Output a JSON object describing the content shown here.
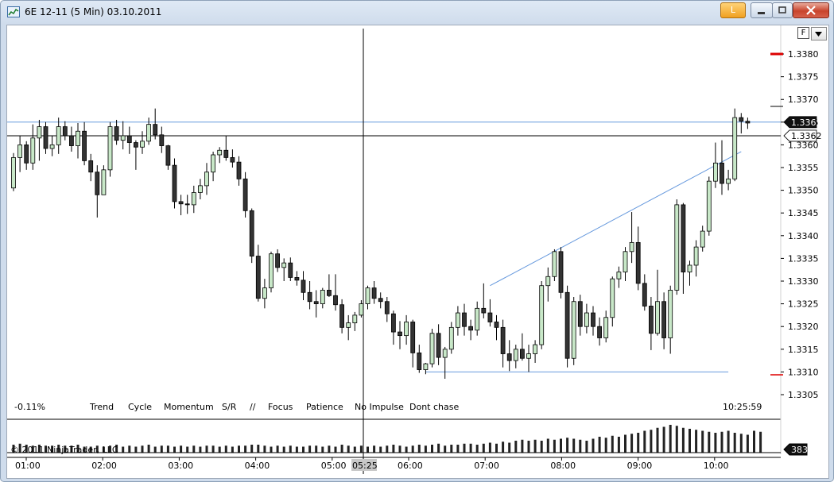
{
  "window": {
    "title": "6E 12-11 (5 Min)  03.10.2011",
    "l_button": "L",
    "f_button": "F"
  },
  "indicators": {
    "change_pct": "-0.11%",
    "labels": [
      "Trend",
      "Cycle",
      "Momentum",
      "S/R",
      "//",
      "Focus",
      "Patience",
      "No Impulse",
      "Dont chase"
    ],
    "clock": "10:25:59"
  },
  "copyright": "© 2011 NinjaTrader, LLC",
  "price_axis": {
    "ticks": [
      "1.3380",
      "1.3375",
      "1.3370",
      "1.3365",
      "1.3360",
      "1.3355",
      "1.3350",
      "1.3345",
      "1.3340",
      "1.3335",
      "1.3330",
      "1.3325",
      "1.3320",
      "1.3315",
      "1.3310",
      "1.3305"
    ],
    "last_price_label": "1.3365",
    "crosshair_price_label": "1.3362",
    "volume_label": "383"
  },
  "time_axis": {
    "ticks": [
      "01:00",
      "02:00",
      "03:00",
      "04:00",
      "05:00",
      "06:00",
      "07:00",
      "08:00",
      "09:00",
      "10:00"
    ],
    "crosshair_time_label": "05:25"
  },
  "colors": {
    "up_fill": "#c8e8c8",
    "down_fill": "#333333",
    "trendline": "#6699dd",
    "crosshair": "#000000",
    "marker_red": "#dd0000"
  },
  "chart_data": {
    "type": "candlestick",
    "instrument": "6E 12-11",
    "interval": "5 Min",
    "date": "03.10.2011",
    "ylim": [
      1.33025,
      1.3385
    ],
    "candles": [
      [
        1.33505,
        1.33582,
        1.33498,
        1.33572
      ],
      [
        1.33572,
        1.3362,
        1.3354,
        1.336
      ],
      [
        1.336,
        1.33608,
        1.33545,
        1.3356
      ],
      [
        1.3356,
        1.33645,
        1.33545,
        1.33615
      ],
      [
        1.33615,
        1.33655,
        1.33565,
        1.3364
      ],
      [
        1.3364,
        1.3365,
        1.3358,
        1.33592
      ],
      [
        1.33592,
        1.3362,
        1.33575,
        1.336
      ],
      [
        1.336,
        1.3366,
        1.3358,
        1.3364
      ],
      [
        1.3364,
        1.33652,
        1.3361,
        1.3362
      ],
      [
        1.3362,
        1.3364,
        1.33585,
        1.33598
      ],
      [
        1.33598,
        1.33648,
        1.3357,
        1.3363
      ],
      [
        1.3363,
        1.3365,
        1.33555,
        1.33565
      ],
      [
        1.33565,
        1.3358,
        1.3352,
        1.3354
      ],
      [
        1.3354,
        1.33555,
        1.3344,
        1.3349
      ],
      [
        1.3349,
        1.33555,
        1.3349,
        1.33545
      ],
      [
        1.33545,
        1.3365,
        1.3353,
        1.3364
      ],
      [
        1.3364,
        1.33655,
        1.336,
        1.3361
      ],
      [
        1.3361,
        1.33652,
        1.3359,
        1.3362
      ],
      [
        1.3362,
        1.3364,
        1.3358,
        1.33605
      ],
      [
        1.33605,
        1.3361,
        1.33545,
        1.33595
      ],
      [
        1.33595,
        1.3363,
        1.3358,
        1.33608
      ],
      [
        1.33608,
        1.3366,
        1.336,
        1.33645
      ],
      [
        1.33645,
        1.3368,
        1.33612,
        1.33622
      ],
      [
        1.33622,
        1.3364,
        1.33582,
        1.33598
      ],
      [
        1.33598,
        1.336,
        1.33545,
        1.33555
      ],
      [
        1.33555,
        1.3357,
        1.3346,
        1.33475
      ],
      [
        1.33475,
        1.3349,
        1.33445,
        1.3347
      ],
      [
        1.3347,
        1.3349,
        1.33448,
        1.33468
      ],
      [
        1.33468,
        1.3351,
        1.3345,
        1.33495
      ],
      [
        1.33495,
        1.33525,
        1.3348,
        1.3351
      ],
      [
        1.3351,
        1.3356,
        1.3349,
        1.3354
      ],
      [
        1.3354,
        1.33585,
        1.3352,
        1.33578
      ],
      [
        1.33578,
        1.33595,
        1.3356,
        1.33588
      ],
      [
        1.33588,
        1.3362,
        1.33565,
        1.33572
      ],
      [
        1.33572,
        1.3359,
        1.3355,
        1.33562
      ],
      [
        1.33562,
        1.33575,
        1.3351,
        1.33525
      ],
      [
        1.33525,
        1.3354,
        1.3344,
        1.33455
      ],
      [
        1.33455,
        1.3346,
        1.3334,
        1.33355
      ],
      [
        1.33355,
        1.3338,
        1.33255,
        1.33262
      ],
      [
        1.33262,
        1.33305,
        1.3324,
        1.33285
      ],
      [
        1.33285,
        1.33365,
        1.33275,
        1.3336
      ],
      [
        1.3336,
        1.3337,
        1.3332,
        1.3333
      ],
      [
        1.3333,
        1.3335,
        1.333,
        1.3334
      ],
      [
        1.3334,
        1.33352,
        1.333,
        1.33308
      ],
      [
        1.33308,
        1.33322,
        1.3329,
        1.33302
      ],
      [
        1.33302,
        1.33322,
        1.33258,
        1.33275
      ],
      [
        1.33275,
        1.333,
        1.33238,
        1.33255
      ],
      [
        1.33255,
        1.3328,
        1.3322,
        1.3325
      ],
      [
        1.3325,
        1.33285,
        1.3324,
        1.3328
      ],
      [
        1.3328,
        1.33315,
        1.33265,
        1.33268
      ],
      [
        1.33268,
        1.33315,
        1.33235,
        1.33248
      ],
      [
        1.33248,
        1.3326,
        1.33185,
        1.33198
      ],
      [
        1.33198,
        1.33225,
        1.3317,
        1.33208
      ],
      [
        1.33208,
        1.33232,
        1.3319,
        1.33225
      ],
      [
        1.33225,
        1.33258,
        1.3322,
        1.3325
      ],
      [
        1.3325,
        1.3329,
        1.33238,
        1.33285
      ],
      [
        1.33285,
        1.333,
        1.3325,
        1.33262
      ],
      [
        1.33262,
        1.33275,
        1.3324,
        1.33255
      ],
      [
        1.33255,
        1.33265,
        1.3321,
        1.33228
      ],
      [
        1.33228,
        1.33235,
        1.3316,
        1.33188
      ],
      [
        1.33188,
        1.33212,
        1.3315,
        1.3318
      ],
      [
        1.3318,
        1.33225,
        1.3316,
        1.3321
      ],
      [
        1.3321,
        1.33215,
        1.3311,
        1.33142
      ],
      [
        1.33142,
        1.3316,
        1.33098,
        1.33105
      ],
      [
        1.33105,
        1.3312,
        1.33095,
        1.33118
      ],
      [
        1.33118,
        1.33195,
        1.3311,
        1.33185
      ],
      [
        1.33185,
        1.33205,
        1.33115,
        1.33132
      ],
      [
        1.33132,
        1.33155,
        1.33085,
        1.3315
      ],
      [
        1.3315,
        1.3321,
        1.3314,
        1.33198
      ],
      [
        1.33198,
        1.33245,
        1.3318,
        1.3323
      ],
      [
        1.3323,
        1.3325,
        1.3318,
        1.332
      ],
      [
        1.332,
        1.33215,
        1.3317,
        1.33192
      ],
      [
        1.33192,
        1.33255,
        1.3318,
        1.3324
      ],
      [
        1.3324,
        1.33295,
        1.33218,
        1.3323
      ],
      [
        1.3323,
        1.3326,
        1.332,
        1.3321
      ],
      [
        1.3321,
        1.33225,
        1.3317,
        1.33198
      ],
      [
        1.33198,
        1.33215,
        1.3311,
        1.3314
      ],
      [
        1.3314,
        1.3317,
        1.33102,
        1.33125
      ],
      [
        1.33125,
        1.3316,
        1.33108,
        1.3315
      ],
      [
        1.3315,
        1.33185,
        1.33125,
        1.3313
      ],
      [
        1.3313,
        1.3316,
        1.331,
        1.3314
      ],
      [
        1.3314,
        1.3317,
        1.3312,
        1.3316
      ],
      [
        1.3316,
        1.333,
        1.3315,
        1.3329
      ],
      [
        1.3329,
        1.3333,
        1.33255,
        1.3331
      ],
      [
        1.3331,
        1.3337,
        1.333,
        1.33365
      ],
      [
        1.33365,
        1.33375,
        1.33262,
        1.33275
      ],
      [
        1.33275,
        1.3329,
        1.3311,
        1.3313
      ],
      [
        1.3313,
        1.33265,
        1.33115,
        1.33255
      ],
      [
        1.33255,
        1.3327,
        1.3318,
        1.332
      ],
      [
        1.332,
        1.3325,
        1.33185,
        1.3323
      ],
      [
        1.3323,
        1.33245,
        1.3318,
        1.332
      ],
      [
        1.332,
        1.3322,
        1.33158,
        1.33175
      ],
      [
        1.33175,
        1.33235,
        1.33165,
        1.3322
      ],
      [
        1.3322,
        1.3331,
        1.332,
        1.33305
      ],
      [
        1.33305,
        1.33332,
        1.33285,
        1.3332
      ],
      [
        1.3332,
        1.33375,
        1.333,
        1.33365
      ],
      [
        1.33365,
        1.33452,
        1.3334,
        1.33385
      ],
      [
        1.33385,
        1.3342,
        1.3328,
        1.33295
      ],
      [
        1.33295,
        1.33315,
        1.33235,
        1.33245
      ],
      [
        1.33245,
        1.33265,
        1.33148,
        1.33185
      ],
      [
        1.33185,
        1.33325,
        1.3318,
        1.33255
      ],
      [
        1.33255,
        1.33275,
        1.3315,
        1.33175
      ],
      [
        1.33175,
        1.3329,
        1.3314,
        1.3328
      ],
      [
        1.3328,
        1.3348,
        1.3327,
        1.33468
      ],
      [
        1.33468,
        1.33472,
        1.33272,
        1.3332
      ],
      [
        1.3332,
        1.33345,
        1.3329,
        1.33335
      ],
      [
        1.33335,
        1.3339,
        1.3331,
        1.33375
      ],
      [
        1.33375,
        1.33422,
        1.33365,
        1.3341
      ],
      [
        1.3341,
        1.3353,
        1.334,
        1.3352
      ],
      [
        1.3352,
        1.33605,
        1.33505,
        1.3356
      ],
      [
        1.3356,
        1.3361,
        1.3349,
        1.33515
      ],
      [
        1.33515,
        1.33545,
        1.335,
        1.33525
      ],
      [
        1.33525,
        1.3368,
        1.3352,
        1.3366
      ],
      [
        1.3366,
        1.3367,
        1.33625,
        1.33652
      ],
      [
        1.33652,
        1.3366,
        1.33635,
        1.33648
      ]
    ],
    "volume": [
      8,
      9,
      8,
      7,
      8,
      7,
      7,
      8,
      7,
      7,
      8,
      6,
      6,
      7,
      6,
      7,
      8,
      6,
      7,
      6,
      7,
      8,
      6,
      7,
      7,
      6,
      7,
      6,
      7,
      6,
      7,
      7,
      6,
      7,
      6,
      7,
      7,
      8,
      8,
      7,
      6,
      7,
      6,
      7,
      6,
      6,
      7,
      7,
      6,
      7,
      6,
      8,
      7,
      6,
      7,
      6,
      7,
      6,
      7,
      8,
      7,
      6,
      7,
      8,
      7,
      8,
      9,
      7,
      8,
      8,
      9,
      9,
      8,
      9,
      10,
      9,
      11,
      10,
      12,
      13,
      12,
      13,
      12,
      14,
      13,
      14,
      15,
      14,
      13,
      12,
      14,
      16,
      15,
      17,
      16,
      18,
      19,
      20,
      22,
      23,
      25,
      26,
      28,
      27,
      25,
      24,
      23,
      22,
      21,
      20,
      21,
      22,
      20,
      19,
      18,
      22,
      21,
      18,
      20,
      19,
      22,
      20,
      19,
      17,
      18,
      21,
      20,
      19,
      18,
      17,
      8
    ],
    "horizontal_lines": [
      {
        "name": "resistance-line",
        "price": 1.3365
      },
      {
        "name": "crosshair-line",
        "price": 1.3362
      },
      {
        "name": "support-line",
        "price": 1.331
      }
    ],
    "trendlines": [
      {
        "name": "rising-channel-line",
        "from_bar": 74,
        "from_price": 1.3329,
        "to_bar": 113,
        "to_price": 1.33585
      }
    ],
    "crosshair": {
      "time": "05:25",
      "price": "1.3362"
    }
  }
}
